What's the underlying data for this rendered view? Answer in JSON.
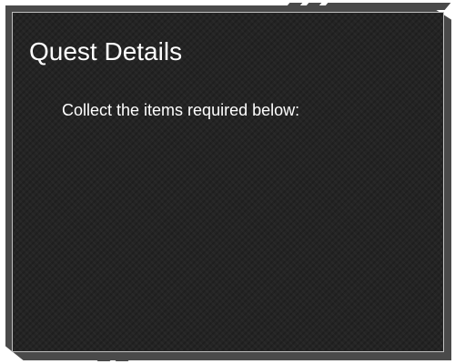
{
  "dialog": {
    "title": "Quest Details",
    "instruction": "Collect the items required below:"
  },
  "colors": {
    "frame": "#4a4a4a",
    "panel": "#242424",
    "border": "#bfbfbf",
    "text": "#ffffff"
  }
}
